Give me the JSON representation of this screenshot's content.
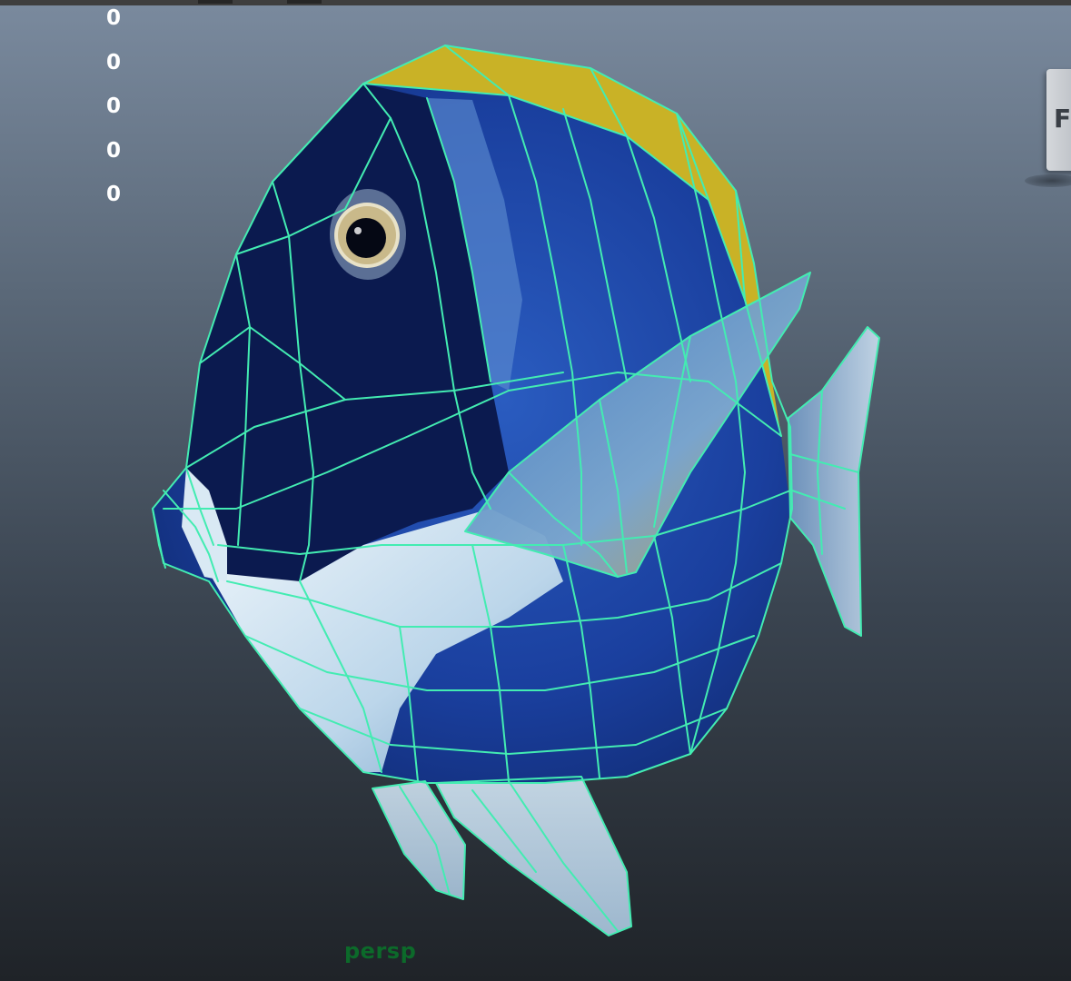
{
  "viewport": {
    "camera": "persp",
    "hud_values": [
      "0",
      "0",
      "0",
      "0",
      "0"
    ],
    "viewcube_label": "F",
    "wireframe_color": "#43ecb2",
    "background_top_color": "#7a8a9e",
    "background_bottom_color": "#1f2328"
  },
  "model": {
    "body_color": "#1a3f9e",
    "dark_color": "#0b1a4f",
    "light_color": "#b8d4ea",
    "yellow_color": "#c9b226",
    "fin_color": "#8fb8d6"
  }
}
